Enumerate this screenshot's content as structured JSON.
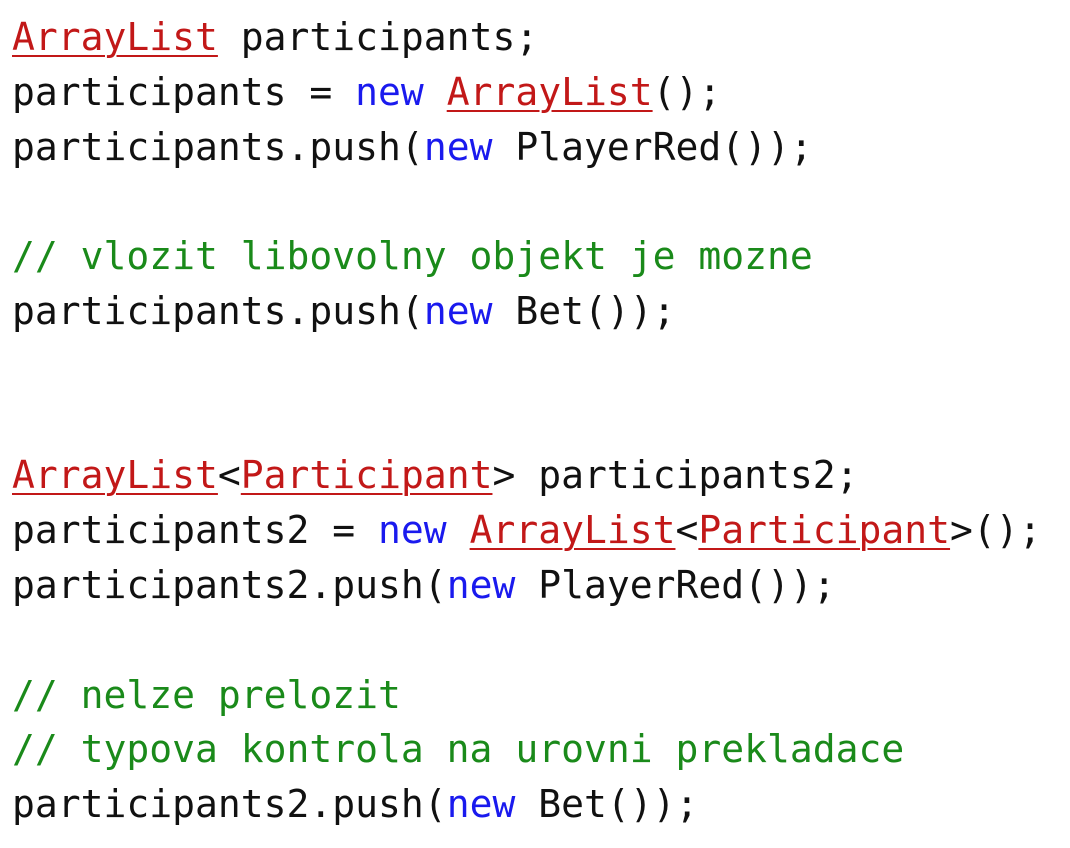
{
  "colors": {
    "plain": "#111111",
    "keyword": "#1a1aee",
    "type": "#c21818",
    "comment": "#1a8a1a"
  },
  "lines": [
    [
      {
        "t": "type",
        "s": "ArrayList"
      },
      {
        "t": "plain",
        "s": " participants;"
      }
    ],
    [
      {
        "t": "plain",
        "s": "participants = "
      },
      {
        "t": "kw",
        "s": "new"
      },
      {
        "t": "plain",
        "s": " "
      },
      {
        "t": "type",
        "s": "ArrayList"
      },
      {
        "t": "plain",
        "s": "();"
      }
    ],
    [
      {
        "t": "plain",
        "s": "participants.push("
      },
      {
        "t": "kw",
        "s": "new"
      },
      {
        "t": "plain",
        "s": " PlayerRed());"
      }
    ],
    [],
    [
      {
        "t": "comment",
        "s": "// vlozit libovolny objekt je mozne"
      }
    ],
    [
      {
        "t": "plain",
        "s": "participants.push("
      },
      {
        "t": "kw",
        "s": "new"
      },
      {
        "t": "plain",
        "s": " Bet());"
      }
    ],
    [],
    [],
    [
      {
        "t": "type",
        "s": "ArrayList"
      },
      {
        "t": "plain",
        "s": "<"
      },
      {
        "t": "type",
        "s": "Participant"
      },
      {
        "t": "plain",
        "s": "> participants2;"
      }
    ],
    [
      {
        "t": "plain",
        "s": "participants2 = "
      },
      {
        "t": "kw",
        "s": "new"
      },
      {
        "t": "plain",
        "s": " "
      },
      {
        "t": "type",
        "s": "ArrayList"
      },
      {
        "t": "plain",
        "s": "<"
      },
      {
        "t": "type",
        "s": "Participant"
      },
      {
        "t": "plain",
        "s": ">();"
      }
    ],
    [
      {
        "t": "plain",
        "s": "participants2.push("
      },
      {
        "t": "kw",
        "s": "new"
      },
      {
        "t": "plain",
        "s": " PlayerRed());"
      }
    ],
    [],
    [
      {
        "t": "comment",
        "s": "// nelze prelozit"
      }
    ],
    [
      {
        "t": "comment",
        "s": "// typova kontrola na urovni prekladace"
      }
    ],
    [
      {
        "t": "plain",
        "s": "participants2.push("
      },
      {
        "t": "kw",
        "s": "new"
      },
      {
        "t": "plain",
        "s": " Bet());"
      }
    ]
  ]
}
